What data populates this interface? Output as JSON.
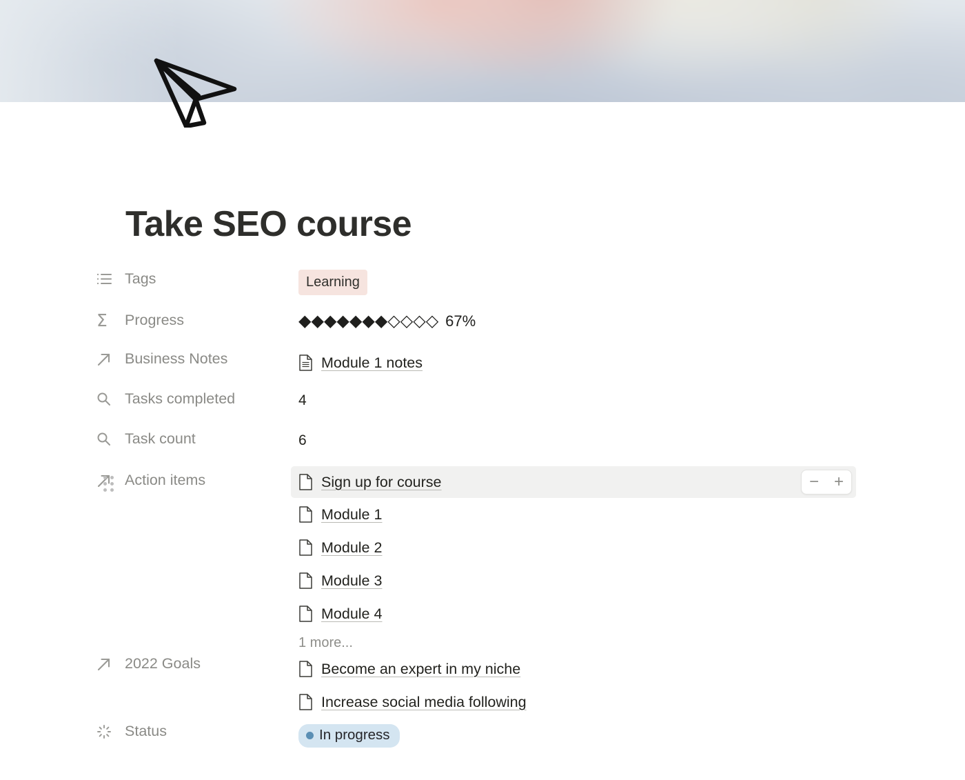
{
  "cover": {
    "alt_description": "blurred photo of bed linen with soft pink and beige objects",
    "doodle_icon": "paper-plane-icon"
  },
  "page": {
    "title": "Take SEO course"
  },
  "properties": [
    {
      "key": "tags",
      "icon": "multi-select-list-icon",
      "label": "Tags",
      "type": "multi_select",
      "tags": [
        {
          "label": "Learning",
          "color": "#f6e4df"
        }
      ]
    },
    {
      "key": "progress",
      "icon": "sigma-rollup-icon",
      "label": "Progress",
      "type": "rollup_progress",
      "filled": 7,
      "total": 11,
      "percent_label": "67%"
    },
    {
      "key": "business_notes",
      "icon": "arrow-up-right-relation-icon",
      "label": "Business Notes",
      "type": "relation",
      "items": [
        {
          "label": "Module 1 notes",
          "icon": "document-lines-icon"
        }
      ]
    },
    {
      "key": "tasks_completed",
      "icon": "search-rollup-icon",
      "label": "Tasks completed",
      "type": "number",
      "value": "4"
    },
    {
      "key": "task_count",
      "icon": "search-rollup-icon",
      "label": "Task count",
      "type": "number",
      "value": "6"
    },
    {
      "key": "action_items",
      "icon": "arrow-up-right-relation-icon",
      "label": "Action items",
      "type": "relation",
      "has_drag_handle": true,
      "items": [
        {
          "label": "Sign up for course",
          "icon": "document-page-icon",
          "highlighted": true
        },
        {
          "label": "Module 1",
          "icon": "document-page-icon",
          "highlighted": false
        },
        {
          "label": "Module 2",
          "icon": "document-page-icon",
          "highlighted": false
        },
        {
          "label": "Module 3",
          "icon": "document-page-icon",
          "highlighted": false
        },
        {
          "label": "Module 4",
          "icon": "document-page-icon",
          "highlighted": false
        }
      ],
      "more_label": "1 more...",
      "stepper": {
        "minus_label": "−",
        "plus_label": "+"
      }
    },
    {
      "key": "goals_2022",
      "icon": "arrow-up-right-relation-icon",
      "label": "2022 Goals",
      "type": "relation",
      "items": [
        {
          "label": "Become an expert in my niche",
          "icon": "document-page-icon"
        },
        {
          "label": "Increase social media following",
          "icon": "document-page-icon"
        }
      ]
    },
    {
      "key": "status",
      "icon": "spinner-status-icon",
      "label": "Status",
      "type": "status",
      "value": "In progress",
      "pill_color": "#d4e5f1",
      "dot_color": "#5b8fb4"
    }
  ]
}
